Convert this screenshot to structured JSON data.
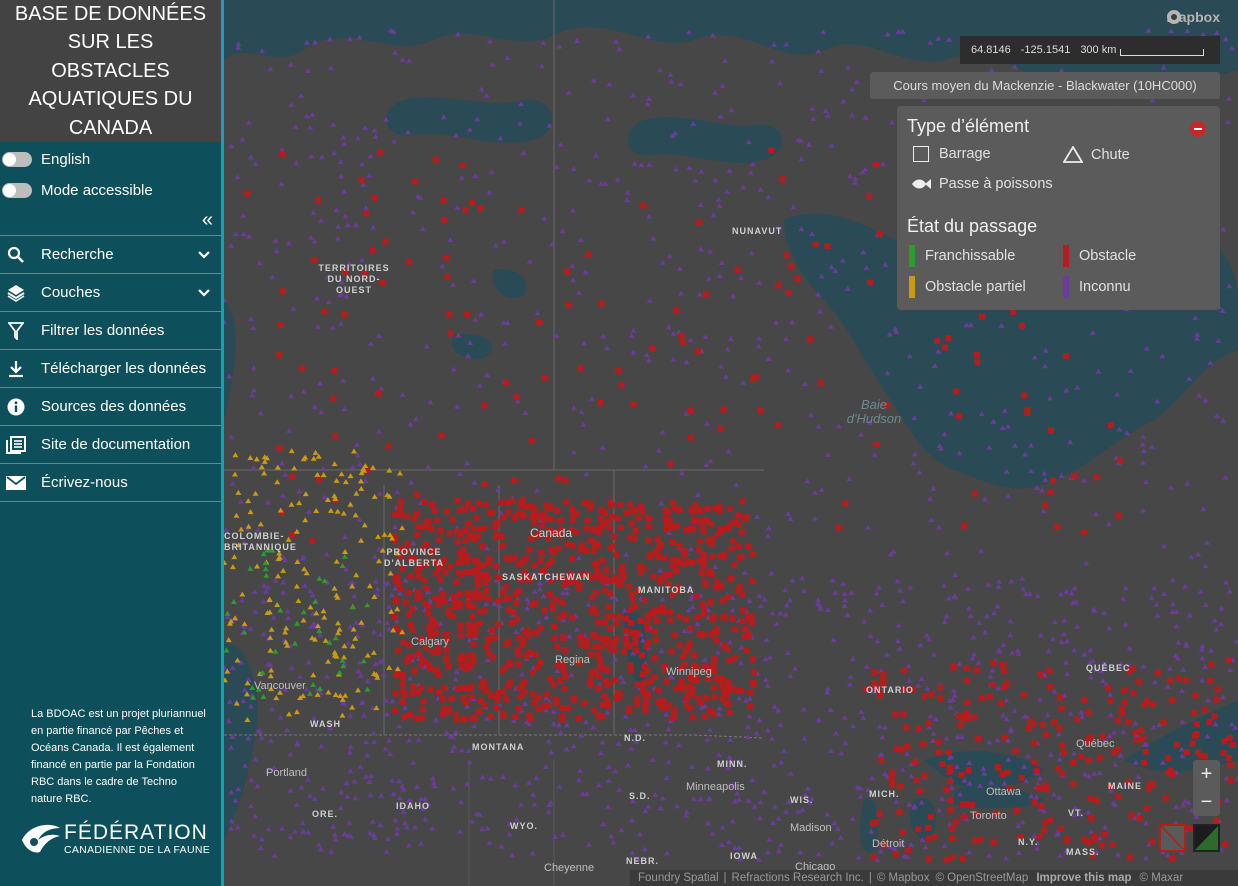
{
  "app": {
    "title": "BASE DE DONNÉES SUR LES OBSTACLES AQUATIQUES DU CANADA"
  },
  "toggles": {
    "english": "English",
    "accessible": "Mode accessible"
  },
  "menu": {
    "collapse_icon": "double-chevron-left-icon",
    "items": [
      {
        "label": "Recherche",
        "icon": "search-icon",
        "expandable": true
      },
      {
        "label": "Couches",
        "icon": "layers-icon",
        "expandable": true
      },
      {
        "label": "Filtrer les données",
        "icon": "filter-icon",
        "expandable": false
      },
      {
        "label": "Télécharger les données",
        "icon": "download-icon",
        "expandable": false
      },
      {
        "label": "Sources des données",
        "icon": "info-icon",
        "expandable": false
      },
      {
        "label": "Site de documentation",
        "icon": "document-icon",
        "expandable": false
      },
      {
        "label": "Écrivez-nous",
        "icon": "mail-icon",
        "expandable": false
      }
    ]
  },
  "footer": {
    "text": "La BDOAC est un projet pluriannuel en partie financé par Pêches et Océans Canada. Il est également financé en partie par la Fondation RBC dans le cadre de Techno nature RBC.",
    "logo_line1": "FÉDÉRATION",
    "logo_line2": "CANADIENNE DE LA FAUNE"
  },
  "map": {
    "mapbox_logo": "mapbox",
    "coordinates": {
      "lat": "64.8146",
      "lon": "-125.1541",
      "scale": "300 km"
    },
    "region": "Cours moyen du Mackenzie - Blackwater (10HC000)",
    "labels": {
      "nunavut": "NUNAVUT",
      "nwt": "TERRITOIRES DU NORD-OUEST",
      "bc": "COLOMBIE-BRITANNIQUE",
      "alberta": "PROVINCE D'ALBERTA",
      "saskatchewan": "SASKATCHEWAN",
      "manitoba": "MANITOBA",
      "ontario": "ONTARIO",
      "quebec": "QUÉBEC",
      "montana": "MONTANA",
      "nd": "N.D.",
      "minn": "MINN.",
      "sd": "S.D.",
      "wis": "WIS.",
      "mich": "MICH.",
      "wash": "WASH",
      "ore": "ORE.",
      "idaho": "IDAHO",
      "wyo": "WYO.",
      "nebr": "NEBR.",
      "iowa": "IOWA",
      "ny": "N.Y.",
      "mass": "MASS.",
      "vt": "VT.",
      "maine": "MAINE",
      "canada": "Canada",
      "winnipeg": "Winnipeg",
      "calgary": "Calgary",
      "regina": "Regina",
      "vancouver": "Vancouver",
      "portland": "Portland",
      "minneapolis": "Minneapolis",
      "madison": "Madison",
      "detroit": "Détroit",
      "toronto": "Toronto",
      "ottawa": "Ottawa",
      "quebec_city": "Québec",
      "chicago": "Chicago",
      "cheyenne": "Cheyenne",
      "hudson_bay": "Baie d'Hudson"
    }
  },
  "legend": {
    "type_title": "Type d’élément",
    "types": {
      "dam": "Barrage",
      "waterfall": "Chute",
      "fishway": "Passe à poissons"
    },
    "passage_title": "État du passage",
    "states": {
      "passable": {
        "label": "Franchissable",
        "color": "#2e9b2e"
      },
      "barrier": {
        "label": "Obstacle",
        "color": "#b71c1c"
      },
      "partial": {
        "label": "Obstacle partiel",
        "color": "#c99a16"
      },
      "unknown": {
        "label": "Inconnu",
        "color": "#6a3d9a"
      }
    }
  },
  "controls": {
    "zoom_in": "+",
    "zoom_out": "−"
  },
  "attribution": {
    "foundry": "Foundry Spatial",
    "refractions": "Refractions Research Inc.",
    "mapbox": "© Mapbox",
    "osm": "© OpenStreetMap",
    "improve": "Improve this map",
    "maxar": "© Maxar"
  }
}
